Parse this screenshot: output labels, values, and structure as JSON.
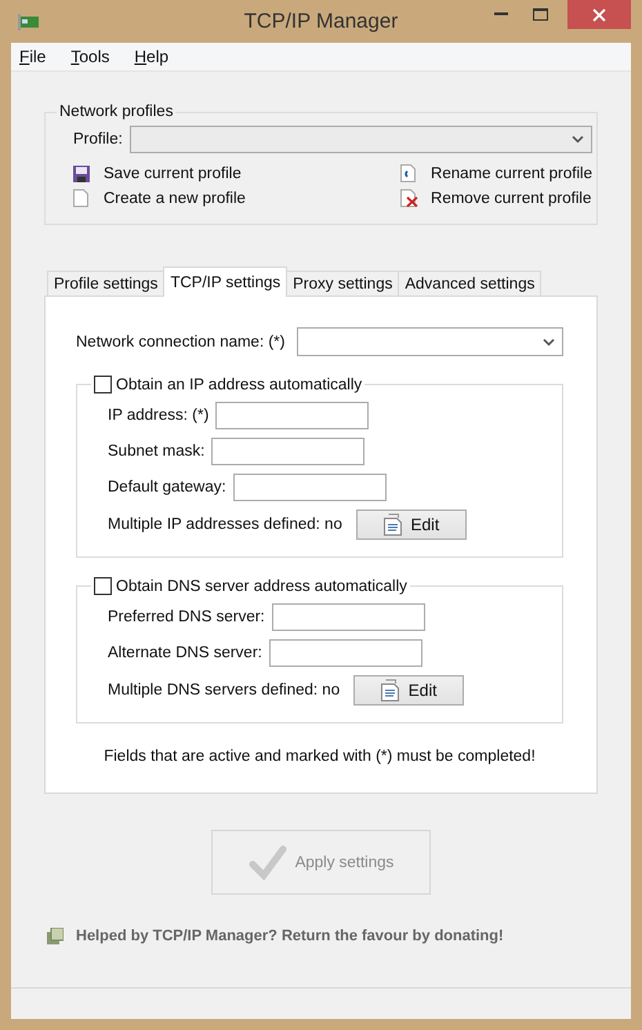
{
  "window": {
    "title": "TCP/IP Manager"
  },
  "menu": [
    {
      "label": "File"
    },
    {
      "label": "Tools"
    },
    {
      "label": "Help"
    }
  ],
  "profiles": {
    "title": "Network profiles",
    "profile_label": "Profile:",
    "actions": [
      {
        "label": "Save current profile",
        "kind": "save"
      },
      {
        "label": "Rename current profile",
        "kind": "rename"
      },
      {
        "label": "Create a new profile",
        "kind": "new"
      },
      {
        "label": "Remove current profile",
        "kind": "remove"
      }
    ]
  },
  "tabs": [
    {
      "label": "Profile settings",
      "selected": false
    },
    {
      "label": "TCP/IP settings",
      "selected": true
    },
    {
      "label": "Proxy settings",
      "selected": false
    },
    {
      "label": "Advanced settings",
      "selected": false
    }
  ],
  "connection_label": "Network connection name: (*)",
  "groups": [
    {
      "checkbox_label": "Obtain an IP address automatically",
      "checked": false,
      "fields": [
        {
          "label": "IP address: (*)"
        },
        {
          "label": "Subnet mask:"
        },
        {
          "label": "Default gateway:"
        }
      ],
      "multiple_label": "Multiple IP addresses defined: no",
      "edit_button": "Edit"
    },
    {
      "checkbox_label": "Obtain DNS server address automatically",
      "checked": false,
      "fields": [
        {
          "label": "Preferred DNS server:"
        },
        {
          "label": "Alternate DNS server:"
        }
      ],
      "multiple_label": "Multiple DNS servers defined: no",
      "edit_button": "Edit"
    }
  ],
  "note": "Fields that are active and marked with (*) must be completed!",
  "apply_button": {
    "label": "Apply settings",
    "disabled": true
  },
  "donate": "Helped by TCP/IP Manager? Return the favour by donating!"
}
